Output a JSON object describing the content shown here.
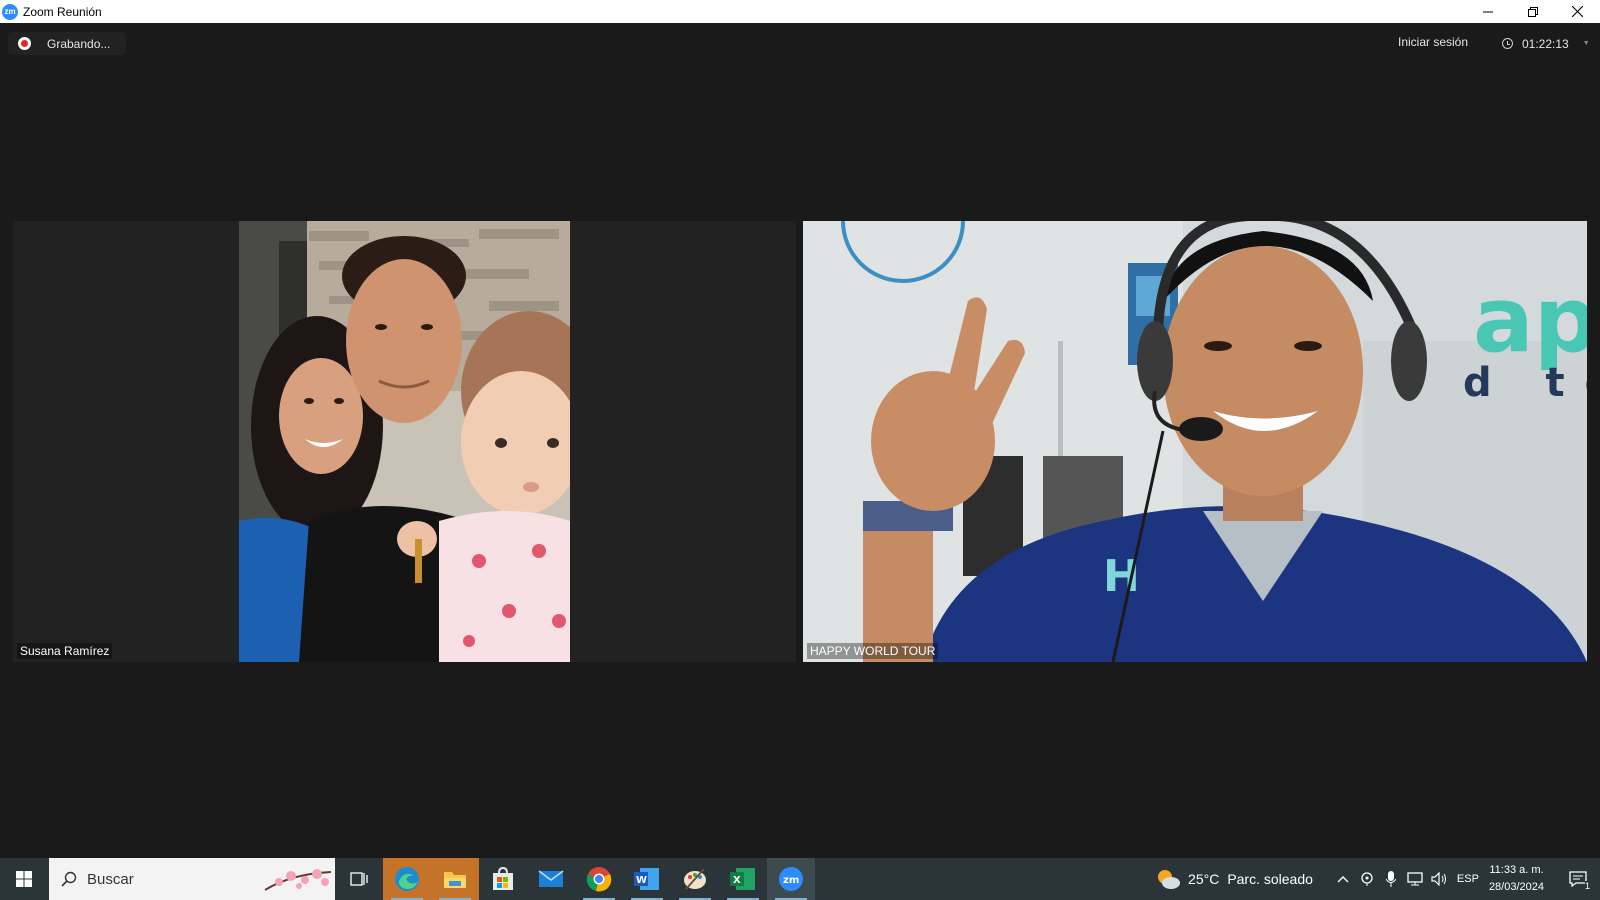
{
  "window": {
    "title": "Zoom Reunión",
    "icon_text": "zm",
    "controls": [
      "minimize-icon",
      "restore-icon",
      "close-icon"
    ]
  },
  "meeting": {
    "recording_label": "Grabando...",
    "signin_label": "Iniciar sesión",
    "elapsed_time": "01:22:13"
  },
  "participants": [
    {
      "name": "Susana Ramírez"
    },
    {
      "name": "HAPPY WORLD TOUR"
    }
  ],
  "taskbar": {
    "search_placeholder": "Buscar",
    "apps": [
      "edge",
      "file-explorer",
      "store",
      "mail",
      "chrome",
      "word",
      "paint",
      "excel",
      "zoom"
    ],
    "weather": {
      "temp": "25°C",
      "condition": "Parc. soleado"
    },
    "language": "ESP",
    "time": "11:33 a. m.",
    "date": "28/03/2024",
    "notification_count": "1"
  },
  "colors": {
    "accent": "#2d8cff",
    "background": "#1a1a1a",
    "taskbar": "#2a3439",
    "recording": "#e02828"
  }
}
